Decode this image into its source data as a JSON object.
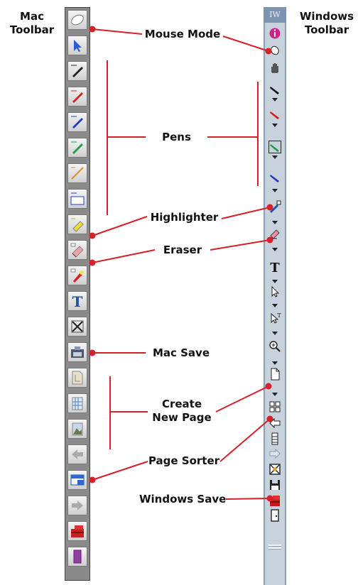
{
  "mac_title": [
    "Mac",
    "Toolbar"
  ],
  "windows_title": [
    "Windows",
    "Toolbar"
  ],
  "labels": {
    "mouse_mode": "Mouse Mode",
    "pens": "Pens",
    "highlighter": "Highlighter",
    "eraser": "Eraser",
    "mac_save": "Mac Save",
    "create_new_page": [
      "Create",
      "New Page"
    ],
    "page_sorter": "Page Sorter",
    "windows_save": "Windows Save"
  },
  "windows_header": "IW",
  "text_tool_glyph": "T",
  "mac_icons": [
    "mouse-icon",
    "arrow-pointer-icon",
    "pen-black-icon",
    "pen-red-icon",
    "pen-blue-icon",
    "pen-green-icon",
    "line-tool-icon",
    "rectangle-tool-icon",
    "highlighter-icon",
    "eraser-icon",
    "spotlight-icon",
    "text-tool-icon",
    "cut-icon",
    "save-icon",
    "new-page-icon",
    "grid-page-icon",
    "image-page-icon",
    "back-arrow-icon",
    "page-sorter-icon",
    "forward-arrow-icon",
    "toolbox-icon",
    "exit-icon"
  ],
  "windows_icons": [
    "info-icon",
    "mouse-icon",
    "hand-icon",
    "pen-black-icon",
    "pen-red-icon",
    "pen-green-icon",
    "pen-blue-icon",
    "highlighter-icon",
    "eraser-icon",
    "text-tool-icon",
    "pointer-icon",
    "text-pointer-icon",
    "zoom-icon",
    "new-page-icon",
    "page-sorter-icon",
    "back-arrow-icon",
    "film-icon",
    "forward-arrow-icon",
    "clear-icon",
    "save-icon",
    "toolbox-icon",
    "exit-icon"
  ],
  "colors": {
    "callout_line": "#d8202a",
    "callout_dot": "#d8202a",
    "bracket_line": "#d8202a"
  }
}
